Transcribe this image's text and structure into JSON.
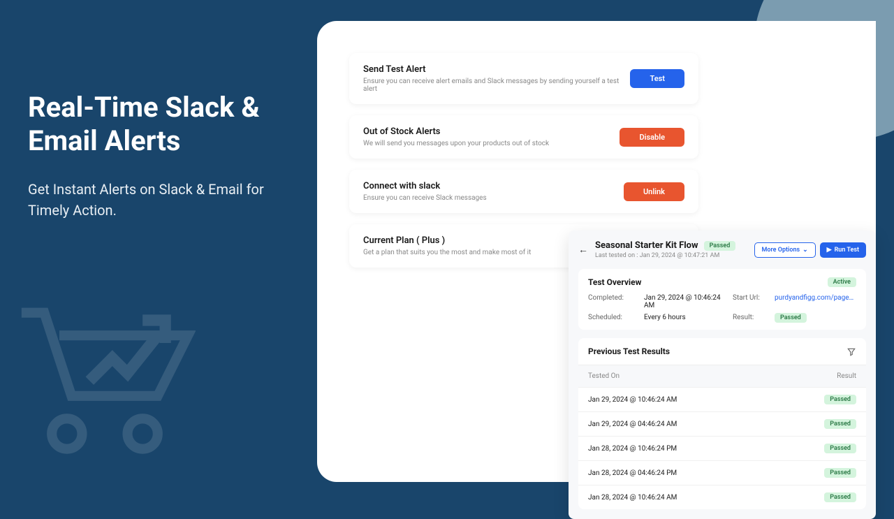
{
  "hero": {
    "title": "Real-Time Slack & Email Alerts",
    "subtitle": "Get Instant Alerts on Slack & Email for Timely Action."
  },
  "alerts": [
    {
      "title": "Send Test Alert",
      "desc": "Ensure you can receive alert emails and Slack messages by sending yourself a test alert",
      "button": "Test",
      "btnClass": "btn-blue"
    },
    {
      "title": "Out of Stock Alerts",
      "desc": "We will send you messages upon your products out of stock",
      "button": "Disable",
      "btnClass": "btn-orange"
    },
    {
      "title": "Connect with slack",
      "desc": "Ensure you can receive Slack messages",
      "button": "Unlink",
      "btnClass": "btn-orange"
    }
  ],
  "plan": {
    "title": "Current Plan ( Plus )",
    "desc": "Get a plan that suits you the most and make most of it"
  },
  "flow": {
    "title": "Seasonal Starter Kit Flow",
    "status": "Passed",
    "lastTested": "Last tested on : Jan 29, 2024 @ 10:47:21 AM",
    "moreOptions": "More Options",
    "runTest": "Run Test"
  },
  "overview": {
    "heading": "Test Overview",
    "statusBadge": "Active",
    "completedLabel": "Completed:",
    "completedValue": "Jan 29, 2024 @ 10:46:24 AM",
    "startUrlLabel": "Start Url:",
    "startUrlValue": "purdyandfigg.com/pages/winter-…",
    "scheduledLabel": "Scheduled:",
    "scheduledValue": "Every 6 hours",
    "resultLabel": "Result:",
    "resultBadge": "Passed"
  },
  "results": {
    "heading": "Previous Test Results",
    "colTested": "Tested On",
    "colResult": "Result",
    "rows": [
      {
        "tested": "Jan 29, 2024 @ 10:46:24 AM",
        "result": "Passed"
      },
      {
        "tested": "Jan 29, 2024 @ 04:46:24 AM",
        "result": "Passed"
      },
      {
        "tested": "Jan 28, 2024 @ 10:46:24 PM",
        "result": "Passed"
      },
      {
        "tested": "Jan 28, 2024 @ 04:46:24 PM",
        "result": "Passed"
      },
      {
        "tested": "Jan 28, 2024 @ 10:46:24 AM",
        "result": "Passed"
      }
    ]
  }
}
